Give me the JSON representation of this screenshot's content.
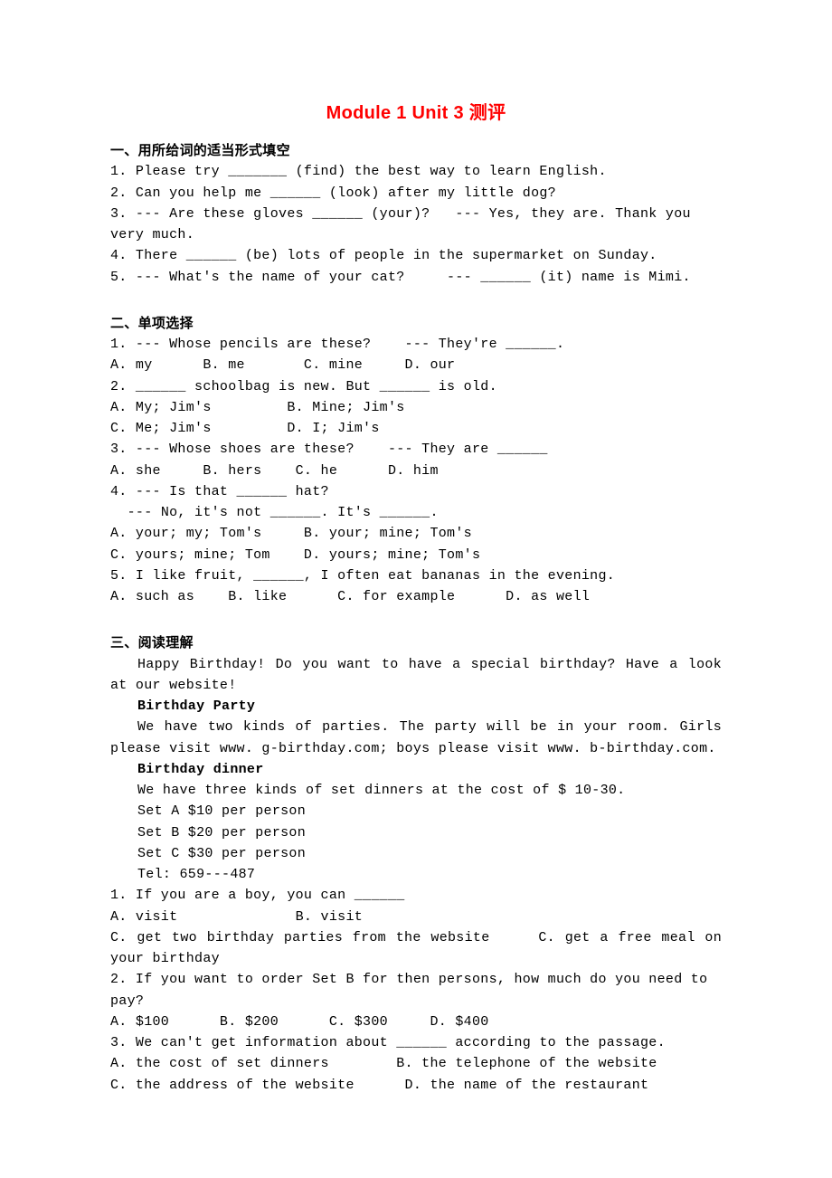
{
  "title": "Module 1 Unit 3 测评",
  "section1": {
    "heading": "一、用所给词的适当形式填空",
    "q1": "1. Please try _______ (find) the best way to learn English.",
    "q2": "2. Can you help me ______ (look) after my little dog?",
    "q3": "3. --- Are these gloves ______ (your)?   --- Yes, they are. Thank you very much.",
    "q4": "4. There ______ (be) lots of people in the supermarket on Sunday.",
    "q5": "5. --- What's the name of your cat?     --- ______ (it) name is Mimi."
  },
  "section2": {
    "heading": "二、单项选择",
    "q1a": "1. --- Whose pencils are these?    --- They're ______.",
    "q1b": "A. my      B. me       C. mine     D. our",
    "q2a": "2. ______ schoolbag is new. But ______ is old.",
    "q2b": "A. My; Jim's         B. Mine; Jim's",
    "q2c": "C. Me; Jim's         D. I; Jim's",
    "q3a": "3. --- Whose shoes are these?    --- They are ______",
    "q3b": "A. she     B. hers    C. he      D. him",
    "q4a": "4. --- Is that ______ hat?",
    "q4b": "  --- No, it's not ______. It's ______.",
    "q4c": "A. your; my; Tom's     B. your; mine; Tom's",
    "q4d": "C. yours; mine; Tom    D. yours; mine; Tom's",
    "q5a": "5. I like fruit, ______, I often eat bananas in the evening.",
    "q5b": "A. such as    B. like      C. for example      D. as well"
  },
  "section3": {
    "heading": "三、阅读理解",
    "p1": "Happy Birthday! Do you want to have a special birthday? Have a look at our website!",
    "sub1": "Birthday Party",
    "p2": "We have two kinds of parties. The party will be in your room. Girls please visit www. g-birthday.com; boys please visit www. b-birthday.com.",
    "sub2": "Birthday dinner",
    "p3": "We have three kinds of set dinners at the cost of $ 10-30.",
    "set_a": "Set A $10 per person",
    "set_b": "Set B $20 per person",
    "set_c": "Set C $30 per person",
    "tel": "Tel: 659---487",
    "q1a": "1. If you are a boy, you can ______",
    "q1b": "A. visit              B. visit",
    "q1c": "C. get two birthday parties from the website     C. get a free meal on your birthday",
    "q2a": "2. If you want to order Set B for then persons, how much do you need to pay?",
    "q2b": "A. $100      B. $200      C. $300     D. $400",
    "q3a": "3. We can't get information about ______ according to the passage.",
    "q3b": "A. the cost of set dinners        B. the telephone of the website",
    "q3c": "C. the address of the website      D. the name of the restaurant"
  }
}
